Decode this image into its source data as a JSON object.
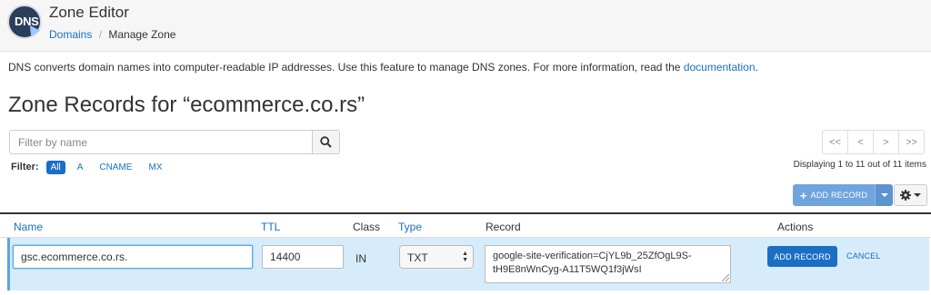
{
  "app": {
    "icon_text": "DNS",
    "title": "Zone Editor",
    "breadcrumb": {
      "parent": "Domains",
      "separator": "/",
      "current": "Manage Zone"
    }
  },
  "description": {
    "text": "DNS converts domain names into computer-readable IP addresses. Use this feature to manage DNS zones. For more information, read the ",
    "link": "documentation",
    "suffix": "."
  },
  "page_title": "Zone Records for “ecommerce.co.rs”",
  "search": {
    "placeholder": "Filter by name",
    "icon": "search-icon"
  },
  "filter": {
    "label": "Filter:",
    "options": [
      "All",
      "A",
      "CNAME",
      "MX"
    ],
    "active": "All"
  },
  "pagination": {
    "buttons": [
      "<<",
      "<",
      ">",
      ">>"
    ],
    "summary": "Displaying 1 to 11 out of 11 items"
  },
  "toolbar": {
    "add_record_label": "ADD RECORD",
    "add_icon": "+",
    "settings_icon": "gear-icon"
  },
  "table": {
    "columns": {
      "name": "Name",
      "ttl": "TTL",
      "class": "Class",
      "type": "Type",
      "record": "Record",
      "actions": "Actions"
    },
    "edit_row": {
      "name_value": "gsc.ecommerce.co.rs.",
      "ttl_value": "14400",
      "class_value": "IN",
      "type_value": "TXT",
      "record_value": "google-site-verification=CjYL9b_25ZfOgL9S-tH9E8nWnCyg-A11T5WQ1f3jWsI",
      "add_label": "ADD RECORD",
      "cancel_label": "CANCEL"
    }
  },
  "colors": {
    "accent": "#1a6fc4",
    "row_highlight": "#d7ecfa",
    "add_button": "#6fa4dc"
  }
}
